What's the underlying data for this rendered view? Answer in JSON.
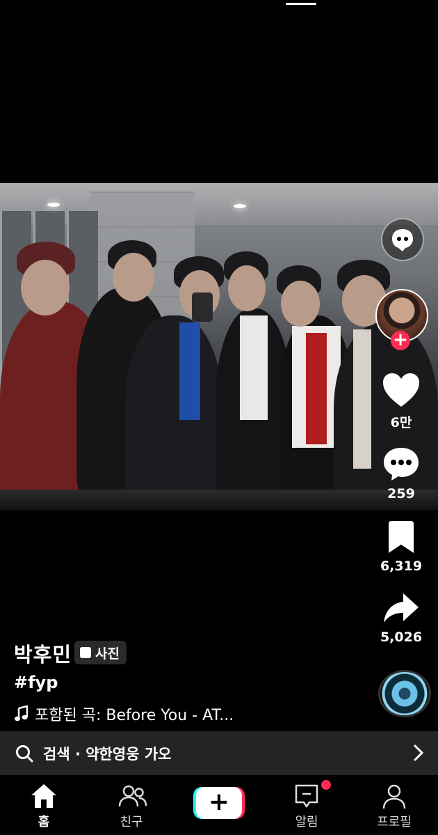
{
  "post": {
    "username": "박후민",
    "type_badge": "사진",
    "caption": "#fyp",
    "music": "포함된 곡: Before You - AT..."
  },
  "actions": {
    "likes": "6만",
    "comments": "259",
    "saves": "6,319",
    "shares": "5,026"
  },
  "search": {
    "text": "검색 · 약한영웅 가오"
  },
  "tabs": [
    {
      "label": "홈",
      "icon": "home-icon",
      "active": true
    },
    {
      "label": "친구",
      "icon": "friends-icon",
      "active": false
    },
    {
      "label": "",
      "icon": "create-plus-icon",
      "active": false
    },
    {
      "label": "알림",
      "icon": "inbox-icon",
      "active": false,
      "badge": true
    },
    {
      "label": "프로필",
      "icon": "profile-icon",
      "active": false
    }
  ],
  "colors": {
    "accent_red": "#fe2c55",
    "accent_cyan": "#25f4ee",
    "search_bg": "#242424"
  }
}
